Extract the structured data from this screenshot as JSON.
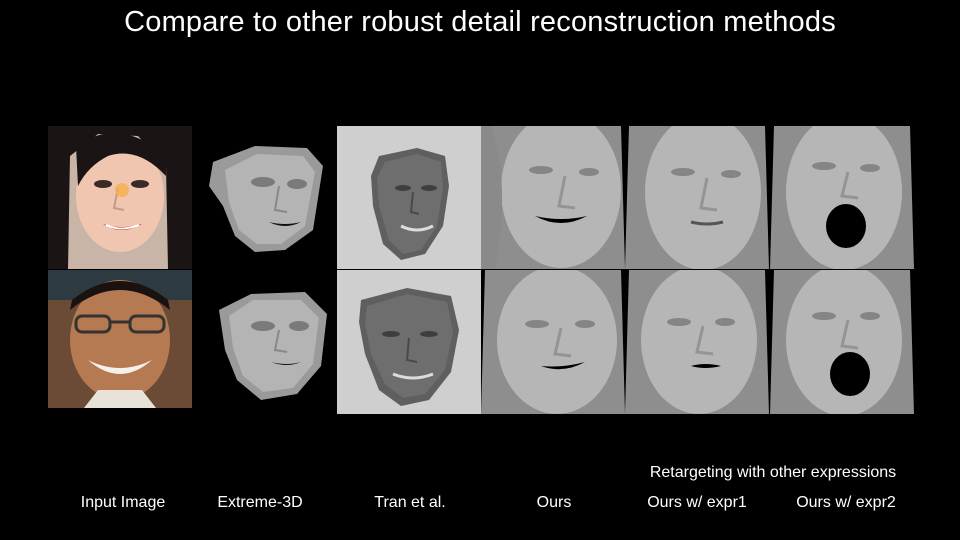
{
  "slide": {
    "title": "Compare to other robust detail reconstruction methods",
    "group_caption": "Retargeting with other expressions",
    "columns": [
      {
        "label": "Input Image"
      },
      {
        "label": "Extreme-3D"
      },
      {
        "label": "Tran et al."
      },
      {
        "label": "Ours"
      },
      {
        "label": "Ours w/ expr1"
      },
      {
        "label": "Ours w/ expr2"
      }
    ]
  },
  "colors": {
    "background": "#000000",
    "text": "#ffffff",
    "mesh_gray": "#b8b8b8",
    "tran_background": "#cfcfcf"
  },
  "icons": {
    "photo": "face-photo",
    "mesh": "face-mesh-render"
  }
}
